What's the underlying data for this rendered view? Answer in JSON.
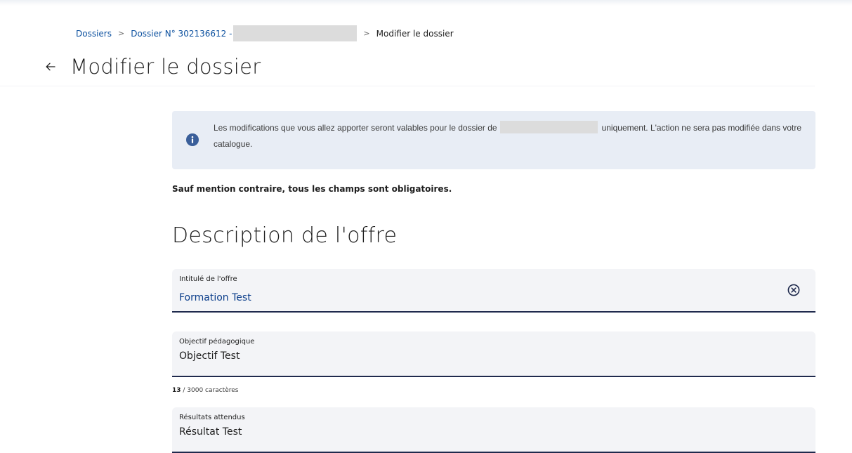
{
  "breadcrumb": {
    "item1": "Dossiers",
    "item2": "Dossier N° 302136612 -",
    "current": "Modifier le dossier",
    "separator": ">"
  },
  "header": {
    "back_icon": "arrow-left-icon",
    "title": "Modifier le dossier"
  },
  "notice": {
    "icon": "info-icon",
    "text_before": "Les modifications que vous allez apporter seront valables pour le dossier de",
    "text_after": "uniquement. L'action ne sera pas modifiée dans votre catalogue."
  },
  "mandatory_note": "Sauf mention contraire, tous les champs sont obligatoires.",
  "section": {
    "title": "Description de l'offre"
  },
  "fields": {
    "intitule": {
      "label": "Intitulé de l'offre",
      "value": "Formation Test",
      "clear_icon": "close-circle-icon"
    },
    "objectif": {
      "label": "Objectif pédagogique",
      "value": "Objectif Test"
    },
    "objectif_counter": {
      "count": "13",
      "suffix": " / 3000 caractères"
    },
    "resultats": {
      "label": "Résultats attendus",
      "value": "Résultat Test"
    }
  },
  "colors": {
    "link": "#0a4f9e",
    "notice_bg": "#e8edf5",
    "field_bg": "#f3f4f7",
    "field_border": "#1f2a4d",
    "value_blue": "#0a3d8a"
  }
}
